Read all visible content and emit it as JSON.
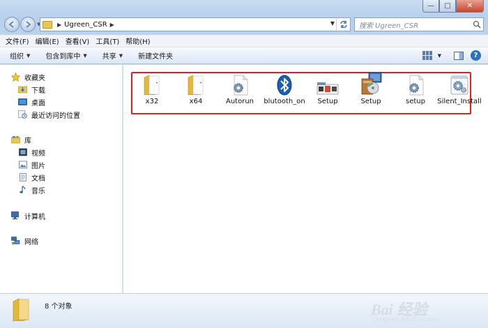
{
  "window": {
    "min_glyph": "—",
    "max_glyph": "□",
    "close_glyph": "✕"
  },
  "address": {
    "path": "Ugreen_CSR"
  },
  "search": {
    "placeholder": "搜索 Ugreen_CSR"
  },
  "menu": {
    "items": [
      "文件(F)",
      "编辑(E)",
      "查看(V)",
      "工具(T)",
      "帮助(H)"
    ]
  },
  "toolbar": {
    "organize": "组织",
    "include_library": "包含到库中",
    "share": "共享",
    "new_folder": "新建文件夹"
  },
  "sidebar": {
    "favorites": "收藏夹",
    "downloads": "下载",
    "desktop": "桌面",
    "recent": "最近访问的位置",
    "libraries": "库",
    "videos": "视频",
    "pictures": "图片",
    "documents": "文档",
    "music": "音乐",
    "computer": "计算机",
    "network": "网络"
  },
  "files": [
    {
      "name": "x32",
      "icon": "folder-icon"
    },
    {
      "name": "x64",
      "icon": "folder-icon"
    },
    {
      "name": "Autorun",
      "icon": "settings-file-icon"
    },
    {
      "name": "blutooth_on",
      "icon": "bluetooth-icon"
    },
    {
      "name": "Setup",
      "icon": "setup-cab-icon"
    },
    {
      "name": "Setup",
      "icon": "installer-icon"
    },
    {
      "name": "setup",
      "icon": "settings-file-icon"
    },
    {
      "name": "Silent_Install",
      "icon": "batch-file-icon"
    }
  ],
  "status": {
    "count": "8 个对象"
  },
  "watermark": {
    "text": "Bai 经验",
    "url": "jingyan.baidu.com"
  },
  "colors": {
    "selection_outline": "#e0201c",
    "folder": "#e6c657",
    "accent": "#2d6fc4"
  }
}
